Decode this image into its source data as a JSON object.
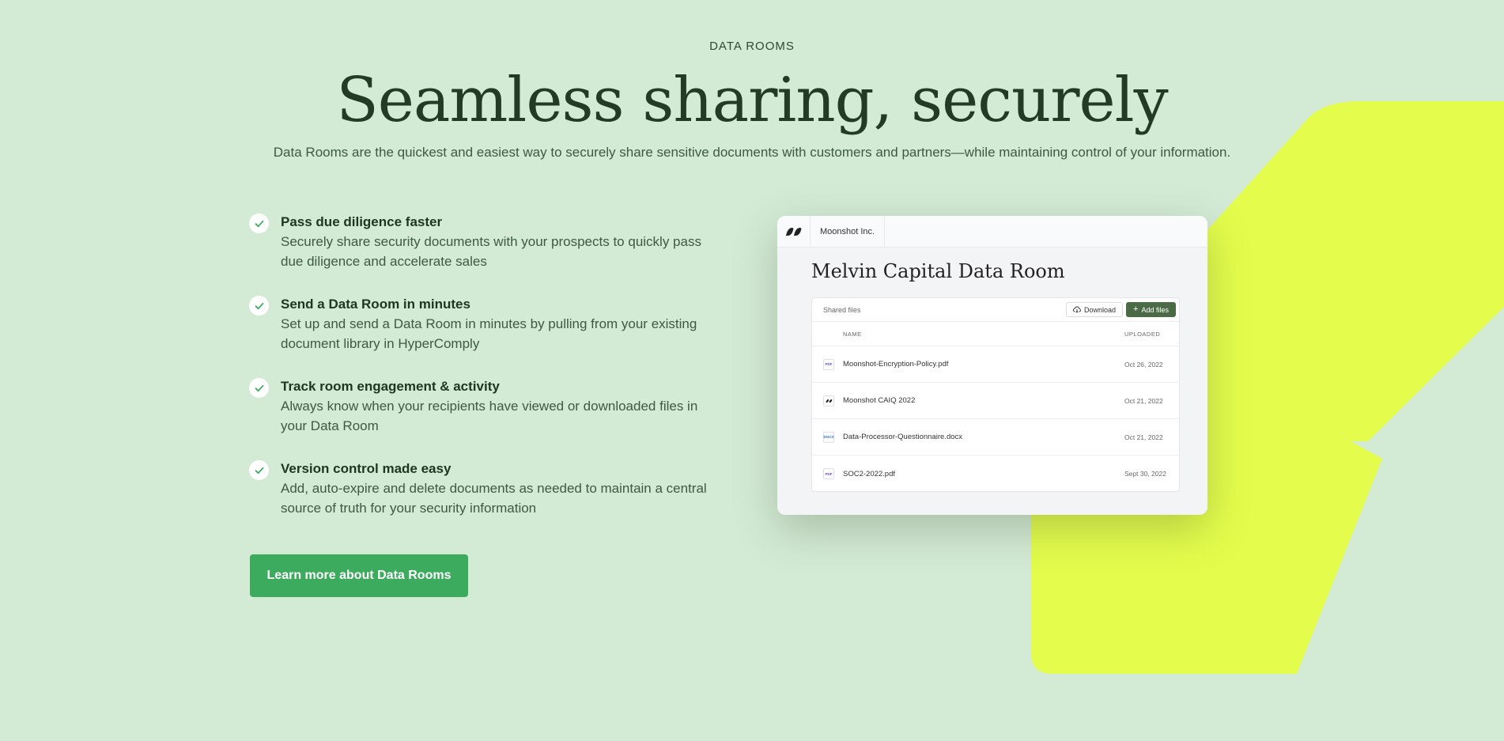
{
  "section": {
    "eyebrow": "DATA ROOMS",
    "headline": "Seamless sharing, securely",
    "subhead": "Data Rooms are the quickest and easiest way to securely share sensitive documents with customers and partners—while maintaining control of your information."
  },
  "features": [
    {
      "title": "Pass due diligence faster",
      "line1": "Securely share security documents with your prospects to quickly pass",
      "line2": "due diligence and accelerate sales",
      "icon": "check-icon"
    },
    {
      "title": "Send a Data Room in minutes",
      "line1": "Set up and send a Data Room in minutes by pulling from your existing",
      "line2": "document library in HyperComply",
      "icon": "check-icon"
    },
    {
      "title": "Track room engagement & activity",
      "line1": "Always know when your recipients have viewed or downloaded files in",
      "line2": "your Data Room",
      "icon": "check-icon"
    },
    {
      "title": "Version control made easy",
      "line1": "Add, auto-expire and delete documents as needed to maintain a central",
      "line2": "source of truth for your security information",
      "icon": "check-icon"
    }
  ],
  "cta": {
    "label": "Learn more about Data Rooms"
  },
  "preview": {
    "org_name": "Moonshot Inc.",
    "room_title": "Melvin Capital Data Room",
    "files_label": "Shared files",
    "download_label": "Download",
    "add_label": "Add files",
    "columns": {
      "name": "NAME",
      "uploaded": "UPLOADED"
    },
    "files": [
      {
        "name": "Moonshot-Encryption-Policy.pdf",
        "date": "Oct 26, 2022",
        "type": "PDF"
      },
      {
        "name": "Moonshot CAIQ 2022",
        "date": "Oct 21, 2022",
        "type": "logo"
      },
      {
        "name": "Data-Processor-Questionnaire.docx",
        "date": "Oct 21, 2022",
        "type": "DOCX"
      },
      {
        "name": "SOC2-2022.pdf",
        "date": "Sept 30, 2022",
        "type": "PDF"
      }
    ]
  },
  "colors": {
    "background": "#d3ead5",
    "accent_shape": "#e4fd4c",
    "cta": "#3cab5e",
    "heading": "#233a24",
    "add_button": "#4b6b47"
  }
}
